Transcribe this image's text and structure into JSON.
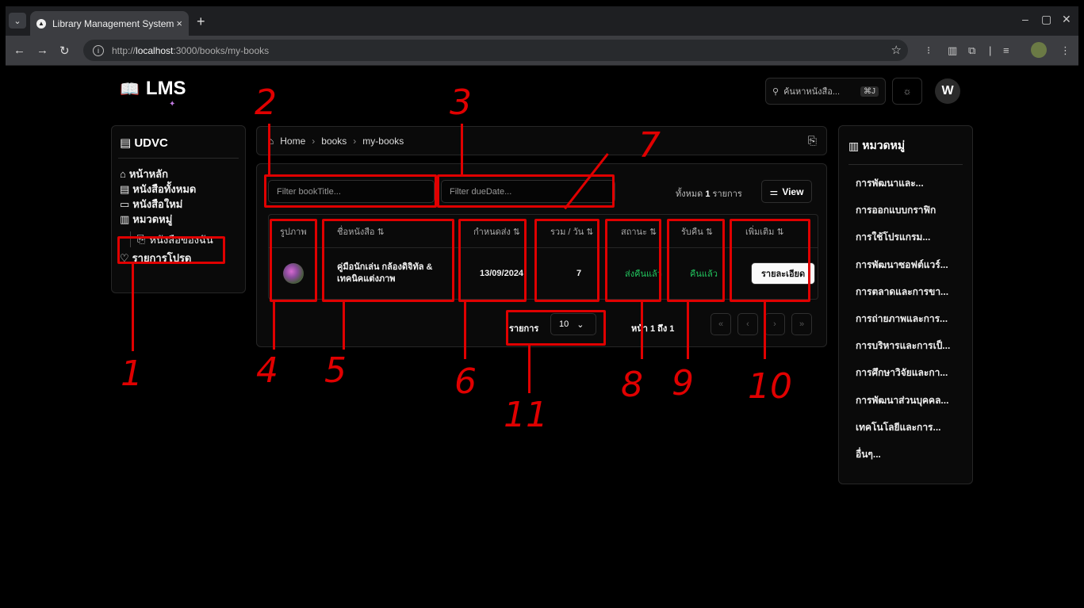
{
  "browser": {
    "tab_title": "Library Management System",
    "url_prefix": "http://",
    "url_host": "localhost",
    "url_path": ":3000/books/my-books",
    "new_tab": "+",
    "close_tab": "×"
  },
  "header": {
    "logo_text": "LMS",
    "search_placeholder": "ค้นหาหนังสือ...",
    "search_shortcut": "⌘J",
    "avatar_initial": "W"
  },
  "sidebar": {
    "title": "UDVC",
    "items": [
      {
        "icon": "home-icon",
        "label": "หน้าหลัก"
      },
      {
        "icon": "book-icon",
        "label": "หนังสือทั้งหมด"
      },
      {
        "icon": "book-icon",
        "label": "หนังสือใหม่"
      },
      {
        "icon": "category-icon",
        "label": "หมวดหมู่"
      },
      {
        "icon": "bookmark-icon",
        "label": "หนังสือของฉัน"
      },
      {
        "icon": "heart-icon",
        "label": "รายการโปรด"
      }
    ]
  },
  "breadcrumb": {
    "items": [
      "Home",
      "books",
      "my-books"
    ],
    "separator": "›"
  },
  "table_tools": {
    "filter_title_placeholder": "Filter bookTitle...",
    "filter_due_placeholder": "Filter dueDate...",
    "total_prefix": "ทั้งหมด",
    "total_count": "1",
    "total_suffix": "รายการ",
    "view_label": "View"
  },
  "table": {
    "columns": [
      "รูปภาพ",
      "ชื่อหนังสือ ⇅",
      "กำหนดส่ง ⇅",
      "รวม / วัน ⇅",
      "สถานะ ⇅",
      "รับคืน ⇅",
      "เพิ่มเติม ⇅"
    ],
    "rows": [
      {
        "title_line1": "คู่มือนักเล่น กล้องดิจิทัล &",
        "title_line2": "เทคนิคแต่งภาพ",
        "due_date": "13/09/2024",
        "days": "7",
        "status": "ส่งคืนแล้ว",
        "returned": "คืนแล้ว",
        "action": "รายละเอียด"
      }
    ]
  },
  "pagination": {
    "rows_label": "รายการ",
    "rows_value": "10",
    "page_info": "หน้า 1 ถึง 1",
    "first": "«",
    "prev": "‹",
    "next": "›",
    "last": "»"
  },
  "categories": {
    "title": "หมวดหมู่",
    "items": [
      "การพัฒนาและ...",
      "การออกแบบกราฟิก",
      "การใช้โปรแกรม...",
      "การพัฒนาซอฟต์แวร์...",
      "การตลาดและการขา...",
      "การถ่ายภาพและการ...",
      "การบริหารและการเป็...",
      "การศึกษาวิจัยและกา...",
      "การพัฒนาส่วนบุคคล...",
      "เทคโนโลยีและการ...",
      "อื่นๆ..."
    ]
  },
  "annotations": {
    "labels": [
      "1",
      "2",
      "3",
      "4",
      "5",
      "6",
      "7",
      "8",
      "9",
      "10",
      "11"
    ],
    "color": "#e00000"
  },
  "colors": {
    "background": "#000000",
    "status_green": "#22c55e",
    "annotation_red": "#e00000"
  }
}
